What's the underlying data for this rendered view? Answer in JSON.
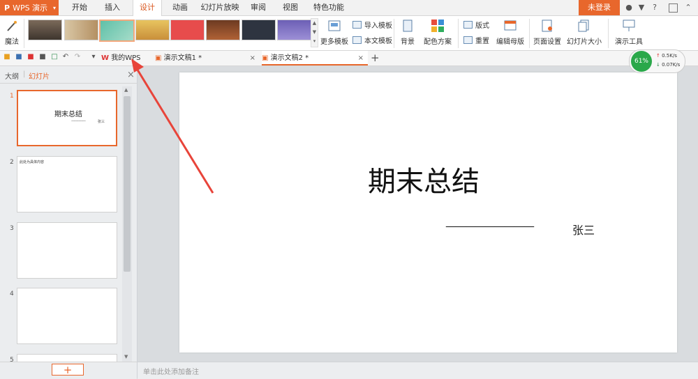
{
  "app": {
    "logo": "P",
    "name": "WPS 演示",
    "menu_caret": "▾"
  },
  "tabs": [
    "开始",
    "插入",
    "设计",
    "动画",
    "幻灯片放映",
    "审阅",
    "视图",
    "特色功能"
  ],
  "active_tab": "设计",
  "login_label": "未登录",
  "top_icons": {
    "help": "?"
  },
  "ribbon": {
    "magic": "魔法",
    "more_templates": "更多模板",
    "import_template": "导入模板",
    "this_template": "本文模板",
    "background": "背景",
    "color_scheme": "配色方案",
    "layout": "版式",
    "reset": "重置",
    "edit_master": "编辑母版",
    "page_setup": "页面设置",
    "slide_size": "幻灯片大小",
    "present_tools": "演示工具"
  },
  "doc_tabs": {
    "my_wps": "我的WPS",
    "doc1": "演示文稿1 *",
    "doc2": "演示文稿2 *",
    "close": "×",
    "new": "+"
  },
  "panel": {
    "outline": "大纲",
    "slides": "幻灯片",
    "close": "×"
  },
  "slides": [
    {
      "num": "1",
      "title": "期末总结",
      "sub": "张三",
      "dashes": "—————"
    },
    {
      "num": "2",
      "text": "此处为具体内容"
    },
    {
      "num": "3"
    },
    {
      "num": "4"
    },
    {
      "num": "5"
    }
  ],
  "add_slide": "+",
  "main_slide": {
    "title": "期末总结",
    "dashes": "—————————",
    "author": "张三"
  },
  "notes_placeholder": "单击此处添加备注",
  "speed": {
    "percent": "61%",
    "up": "0.5K/s",
    "down": "0.07K/s"
  },
  "colors": {
    "accent": "#e8672c",
    "arrow": "#e8443a"
  }
}
